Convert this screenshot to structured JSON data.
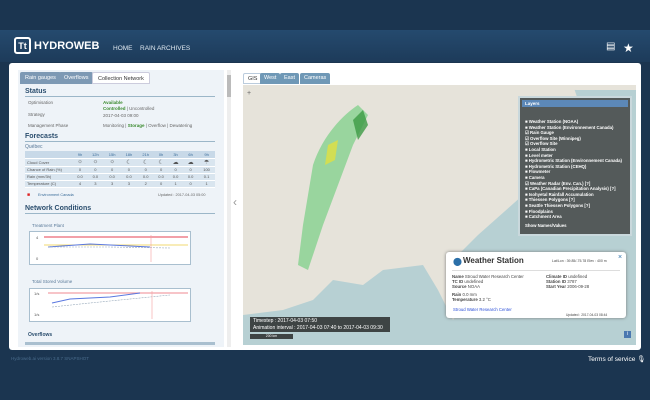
{
  "header": {
    "logo": "Tt",
    "title": "HYDROWEB",
    "nav": [
      "HOME",
      "RAIN ARCHIVES"
    ]
  },
  "left_tabs": [
    "Rain gauges",
    "Overflows",
    "Collection Network"
  ],
  "status": {
    "title": "Status",
    "rows": [
      {
        "label": "Optimisation",
        "value": "Available"
      },
      {
        "label": "Strategy",
        "value_active": "Controlled",
        "value_rest": " | Uncontrolled",
        "sub": "2017-04-03 09:00"
      },
      {
        "label": "Management Phase",
        "pre": "Monitoring | ",
        "active": "Storage",
        "post": " | Overflow | Dewatering"
      }
    ]
  },
  "forecasts": {
    "title": "Forecasts",
    "city": "Québec",
    "hours": [
      "9h",
      "12h",
      "15h",
      "18h",
      "21h",
      "0h",
      "3h",
      "6h",
      "9h"
    ],
    "cloud_label": "Cloud Cover",
    "cloud_icons": [
      "☼",
      "☼",
      "☼",
      "☾",
      "☾",
      "☾",
      "☁",
      "☁",
      "☂"
    ],
    "rows": [
      {
        "label": "Chance of Rain (%)",
        "values": [
          "0",
          "0",
          "0",
          "0",
          "0",
          "0",
          "0",
          "0",
          "100"
        ]
      },
      {
        "label": "Rain (mm/3h)",
        "values": [
          "0.0",
          "0.0",
          "0.0",
          "0.0",
          "0.0",
          "0.0",
          "0.0",
          "0.0",
          "0.1"
        ]
      },
      {
        "label": "Temperature (C)",
        "values": [
          "4",
          "3",
          "3",
          "3",
          "2",
          "0",
          "1",
          "0",
          "1"
        ]
      }
    ],
    "source": "Environment Canada",
    "updated": "Updated : 2017-04-03 05:00"
  },
  "network": {
    "title": "Network Conditions",
    "chart1": {
      "title": "Treatment Plant",
      "ymax": "4",
      "ymin": "0"
    },
    "chart2": {
      "title": "Total Stored Volume",
      "ymax": "1/s",
      "ymin": "1/s"
    },
    "overflows": "Overflows"
  },
  "map_tabs": [
    "GIS",
    "West",
    "East",
    "Cameras"
  ],
  "layers": {
    "title": "Layers",
    "items": [
      {
        "l": "Weather Station (NOAA)",
        "c": false
      },
      {
        "l": "Weather Station (Environnement Canada)",
        "c": false
      },
      {
        "l": "Rain Gauge",
        "c": true
      },
      {
        "l": "Overflow Site (Winnipeg)",
        "c": true
      },
      {
        "l": "Overflow Site",
        "c": true
      },
      {
        "l": "Local Station",
        "c": false
      },
      {
        "l": "Level meter",
        "c": false
      },
      {
        "l": "Hydrometric Station (Environnement Canada)",
        "c": false
      },
      {
        "l": "Hydrometric Station (CEHQ)",
        "c": false
      },
      {
        "l": "Flowmeter",
        "c": false
      },
      {
        "l": "Camera",
        "c": false
      },
      {
        "l": "Weather Radar (Env. Can.) [?]",
        "c": true
      },
      {
        "l": "CaPa (Canadian Precipitation Analysis) [?]",
        "c": false
      },
      {
        "l": "Isohyetal Rainfall Accumulation",
        "c": false
      },
      {
        "l": "Thiessen Polygons [?]",
        "c": false
      },
      {
        "l": "Seattle Thiessen Polygons [?]",
        "c": false
      },
      {
        "l": "Floodplains",
        "c": false
      },
      {
        "l": "Catchment Area",
        "c": false
      }
    ],
    "show": "Show Names/Values"
  },
  "popup": {
    "title": "Weather Station",
    "latlon": "Lat/Lon : 39.85/-75.78 Elev : 400 m",
    "name_l": "Name",
    "name": "Stroud Water Research Center",
    "tc_l": "TC ID",
    "tc": "undefined",
    "src_l": "Source",
    "src": "NOAA",
    "clim_l": "Climate ID",
    "clim": "undefined",
    "sid_l": "Station ID",
    "sid": "3787",
    "sy_l": "Start Year",
    "sy": "2006-09-28",
    "rain_l": "Rain",
    "rain": "0.0 mm",
    "temp_l": "Temperature",
    "temp": "3.2 °C",
    "link": "Stroud Water Research Center",
    "updated": "Updated : 2017-04-03 08:44"
  },
  "timestep": "Timestep : 2017-04-03 07:50",
  "interval": "Animation interval : 2017-04-03 07:40 to 2017-04-03 09:30",
  "scale": "200 km",
  "footer": {
    "version": "Hydroweb.ai version 3.8.7 SNAPSHOT",
    "tos": "Terms of service"
  }
}
